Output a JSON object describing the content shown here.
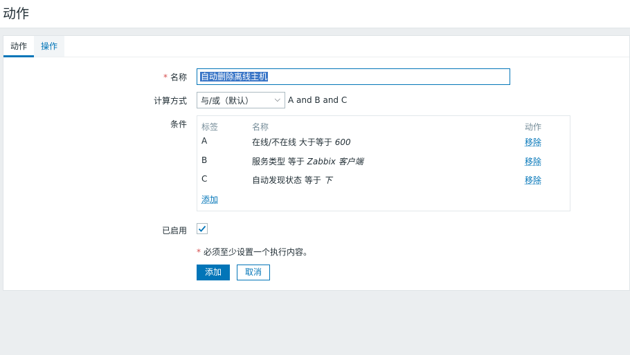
{
  "page": {
    "title": "动作"
  },
  "tabs": [
    {
      "label": "动作",
      "active": true
    },
    {
      "label": "操作",
      "active": false
    }
  ],
  "form": {
    "name_label": "名称",
    "name_value": "自动删除离线主机",
    "calc_label": "计算方式",
    "calc_selected": "与/或（默认）",
    "calc_formula": "A and B and C",
    "conditions_label": "条件",
    "conditions": {
      "headers": {
        "tag": "标签",
        "name": "名称",
        "action": "动作"
      },
      "rows": [
        {
          "tag": "A",
          "name_prefix": "在线/不在线 大于等于 ",
          "name_value": "600",
          "action": "移除"
        },
        {
          "tag": "B",
          "name_prefix": "服务类型 等于 ",
          "name_value": "Zabbix 客户端",
          "action": "移除"
        },
        {
          "tag": "C",
          "name_prefix": "自动发现状态 等于 ",
          "name_value": "下",
          "action": "移除"
        }
      ],
      "add_label": "添加"
    },
    "enabled_label": "已启用",
    "enabled": true,
    "note": "必须至少设置一个执行内容。",
    "required_mark": "*"
  },
  "buttons": {
    "add": "添加",
    "cancel": "取消"
  },
  "colors": {
    "accent": "#0275b8",
    "required": "#d64e4e"
  }
}
